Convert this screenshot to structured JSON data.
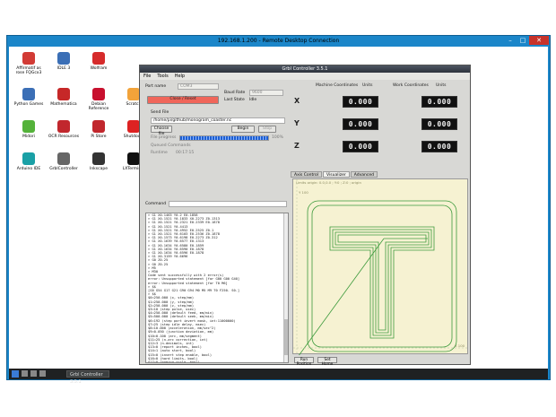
{
  "rdp": {
    "title": "192.168.1.200 - Remote Desktop Connection"
  },
  "desktop_icons": [
    {
      "label": "Affirmatif as rose FQGcx3",
      "color": "#d23b35"
    },
    {
      "label": "IDLE 3",
      "color": "#3b6fb6"
    },
    {
      "label": "Wolfram",
      "color": "#d62b2b"
    },
    {
      "label": "Python Games",
      "color": "#3b6fb6"
    },
    {
      "label": "Mathematica",
      "color": "#c62828"
    },
    {
      "label": "Debian Reference",
      "color": "#c8102e"
    },
    {
      "label": "Scratch",
      "color": "#f2a33a"
    },
    {
      "label": "Midori",
      "color": "#54b23a"
    },
    {
      "label": "OCR Resources",
      "color": "#c1272d"
    },
    {
      "label": "Pi Store",
      "color": "#c1272d"
    },
    {
      "label": "Shutdown",
      "color": "#d22"
    },
    {
      "label": "Arduino IDE",
      "color": "#1aa0a6"
    },
    {
      "label": "GrblController",
      "color": "#666"
    },
    {
      "label": "Inkscape",
      "color": "#333"
    },
    {
      "label": "LXTerminal",
      "color": "#111"
    }
  ],
  "app": {
    "title": "Grbl Controller 3.5.1",
    "menu": [
      "File",
      "Tools",
      "Help"
    ],
    "port_name_label": "Port name",
    "port_name_value": "COM3",
    "baud_rate_label": "Baud Rate",
    "baud_rate_value": "9600",
    "open_close_label": "Close / Reset",
    "last_state_label": "Last State",
    "last_state_value": "Idle",
    "send_file_label": "Send File",
    "file_path": "/home/pi/github/monogram_coaster.nc",
    "choose_file_label": "Choose file",
    "begin_label": "Begin",
    "stop_label": "Stop",
    "file_progress_label": "File progress",
    "file_progress_percent_text": "100%",
    "file_progress": 1.0,
    "queued_label": "Queued Commands",
    "runtime_label": "Runtime",
    "runtime_value": "00:17:15",
    "command_label": "Command",
    "console_lines": [
      "> G1 X0.1463 Y0.2 E0.1858",
      "> G1 X0.1521 Y0.1833 X0.2273 Z0.1313",
      "> G1 X0.1521 Y0.2321 E0.2339 E0.1878",
      "> G1 X0.1521 Y0.4413",
      "> G1 X0.1521 Y0.4952 E0.2525 Z0.1",
      "> G1 X0.1521 Y0.6103 E0.2536 Z0.1878",
      "> G1 X0.1573 Y0.6198 E0.2273 Z0.312",
      "> G1 X0.1639 Y0.6577 E0.1313",
      "> G1 X0.1634 Y0.6580 E0.1859",
      "> G1 X0.1634 Y0.6590 E0.1878",
      "> G1 X0.1634 Y0.6596 E0.1878",
      "> G1 X0.3159 Y0.6696",
      "> G0 Z0.25",
      "> G0 Z0.25",
      "> M5",
      "> M30",
      "Code sent successfully with 2 error(s)",
      "error: Unsupported statement [for G00 G00 G40]",
      "error: Unsupported statement [for T0 M6]",
      "> $$",
      "[G0 G54 G17 G21 G90 G94 M0 M5 M9 T0 F250. S0.]",
      "> $$",
      "$0=250.000 (x, step/mm)",
      "$1=250.000 (y, step/mm)",
      "$2=250.000 (z, step/mm)",
      "$3=10 (step pulse, usec)",
      "$4=250.000 (default feed, mm/min)",
      "$5=500.000 (default seek, mm/min)",
      "$6=192 (step port invert mask, int:11000000)",
      "$7=25 (step idle delay, msec)",
      "$8=10.000 (acceleration, mm/sec^2)",
      "$9=0.050 (junction deviation, mm)",
      "$10=0.100 (arc, mm/segment)",
      "$11=25 (n-arc correction, int)",
      "$12=3 (n-decimals, int)",
      "$13=0 (report inches, bool)",
      "$14=1 (auto start, bool)",
      "$15=0 (invert step enable, bool)",
      "$16=0 (hard limits, bool)",
      "$17=0 (homing cycle, bool)",
      "$18=0 (homing dir invert mask, int:00000000)",
      "$19=25.000 (homing feed, mm/min)",
      "$20=250.000 (homing seek, mm/min)",
      "$21=100 (homing debounce, msec)",
      "$22=1.000 (homing pull-off, mm)",
      "> G0 Z1.352",
      "> G0 X0 Y0 Z0"
    ],
    "machine_coords_label": "Machine Coordinates",
    "work_coords_label": "Work Coordinates",
    "units_label": "Units",
    "axes": [
      "X",
      "Y",
      "Z"
    ],
    "machine_coords": [
      "0.000",
      "0.000",
      "0.000"
    ],
    "work_coords": [
      "0.000",
      "0.000",
      "0.000"
    ],
    "tabs": [
      "Axis Control",
      "Visualizer",
      "Advanced"
    ],
    "viz_top_label": "Limits origin: 0.0,0.0 ; Y:0 ; Z:0 ; origin",
    "viz_x_label": "X 100",
    "viz_y_label": "Y 100",
    "button_run": "Run Position",
    "button_zero": "Set Home"
  }
}
